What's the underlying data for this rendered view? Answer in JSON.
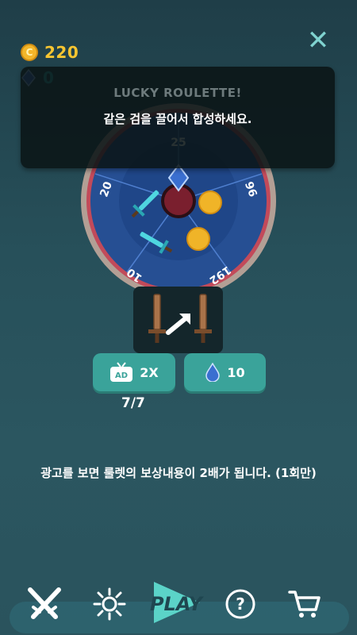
{
  "currency": {
    "coins": "220",
    "gems": "0"
  },
  "dialog": {
    "title": "LUCKY ROULETTE!",
    "message": "같은 검을 끌어서 합성하세요."
  },
  "wheel": {
    "top_value": "25",
    "left_value": "20",
    "right_value": "96",
    "bottom_left_value": "10",
    "bottom_right_value": "192",
    "segments": [
      "gem",
      "coin",
      "coin",
      "sword",
      "sword"
    ]
  },
  "buttons": {
    "ad_badge": "AD",
    "ad_multiplier": "2X",
    "gem_cost": "10"
  },
  "spin_counter": "7/7",
  "info_text": "광고를 보면 룰렛의 보상내용이 2배가 됩니다. (1회만)",
  "nav": {
    "play_label": "PLAY"
  },
  "colors": {
    "accent_teal": "#3aa39a",
    "coin_gold": "#f7c531",
    "wheel_blue": "#2a5fa8",
    "wheel_rim": "#b8a79c",
    "dialog_bg": "#0a1416"
  }
}
